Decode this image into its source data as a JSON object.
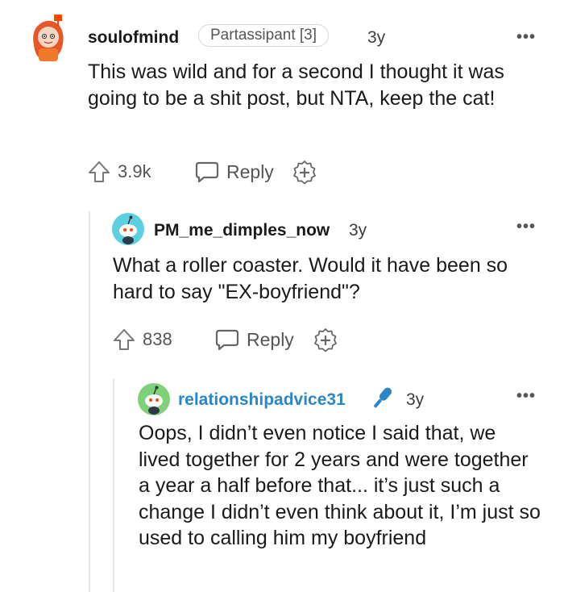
{
  "comments": [
    {
      "username": "soulofmind",
      "flair": "Partassipant [3]",
      "time": "3y",
      "body": "This was wild and for a second I thought it was going to be a shit post, but NTA, keep the cat!",
      "upvotes": "3.9k",
      "reply_label": "Reply"
    },
    {
      "username": "PM_me_dimples_now",
      "time": "3y",
      "body": "What a roller coaster. Would it have been so hard to say \"EX-boyfriend\"?",
      "upvotes": "838",
      "reply_label": "Reply"
    },
    {
      "username": "relationshipadvice31",
      "time": "3y",
      "body": "Oops, I didn’t even notice I said that, we lived together for 2 years and were together a year a half before that... it’s just such a change I didn’t even think about it, I’m just so used to calling him my boyfriend"
    }
  ],
  "more_label": "•••",
  "colors": {
    "mod_name": "#2a86c6",
    "mic_icon": "#2a86c6",
    "avatar_1_bg": "#ff7a33",
    "avatar_2_bg": "#5dd0e0",
    "avatar_3_bg": "#7ed07a"
  },
  "icons": [
    "upvote-icon",
    "reply-bubble-icon",
    "award-icon",
    "microphone-icon",
    "overflow-menu-icon"
  ]
}
